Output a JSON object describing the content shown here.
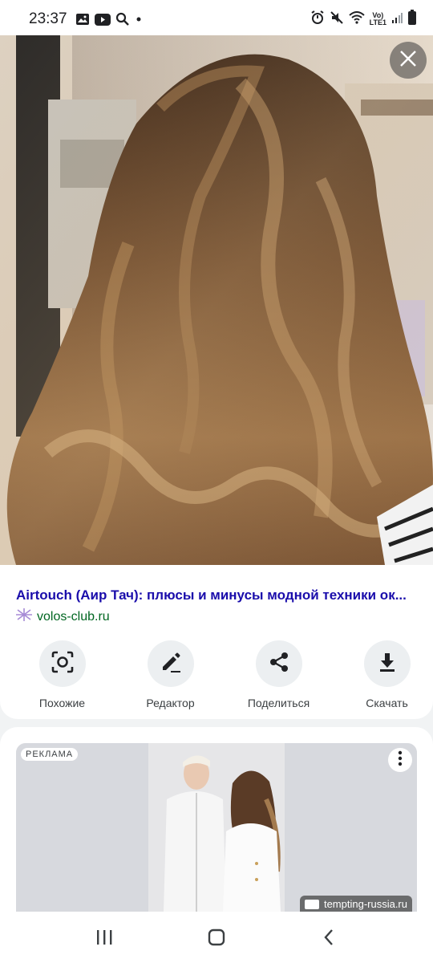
{
  "status_bar": {
    "time": "23:37",
    "left_icons": [
      "image-icon",
      "youtube-icon",
      "search-icon",
      "dot-icon"
    ],
    "right_icons": [
      "alarm-icon",
      "mute-icon",
      "wifi-icon",
      "signal-icon",
      "battery-icon"
    ],
    "network_label_top": "Vo)",
    "network_label_bottom": "LTE1"
  },
  "viewer": {
    "close_icon": "close-icon",
    "image_description_icon": "hair-photo"
  },
  "result": {
    "title": "Airtouch (Аир Тач): плюсы и минусы модной техники ок...",
    "source": "volos-club.ru",
    "source_icon": "site-favicon-icon",
    "title_color": "#1a0dab",
    "source_color": "#006621"
  },
  "actions": [
    {
      "label": "Похожие",
      "icon": "lens-icon"
    },
    {
      "label": "Редактор",
      "icon": "pencil-icon"
    },
    {
      "label": "Поделиться",
      "icon": "share-icon"
    },
    {
      "label": "Скачать",
      "icon": "download-icon"
    }
  ],
  "ad": {
    "badge": "РЕКЛАМА",
    "source": "tempting-russia.ru",
    "menu_icon": "more-vert-icon"
  },
  "nav": {
    "icons": [
      "recents-icon",
      "home-icon",
      "back-icon"
    ]
  }
}
